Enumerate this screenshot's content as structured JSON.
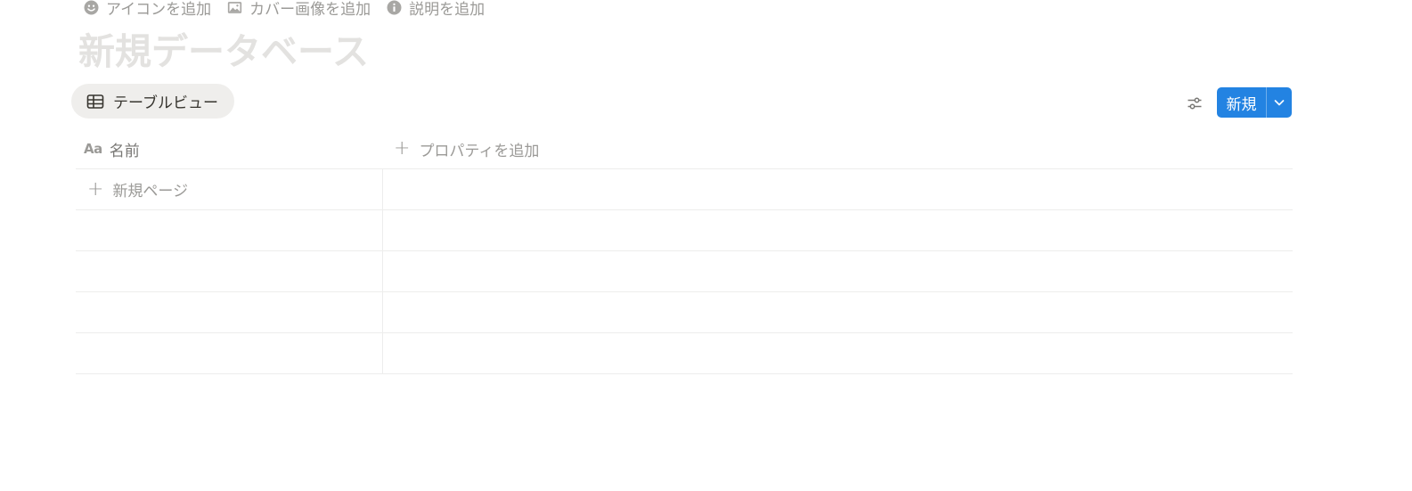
{
  "page_actions": {
    "add_icon": "アイコンを追加",
    "add_cover": "カバー画像を追加",
    "add_description": "説明を追加"
  },
  "database": {
    "title": "新規データベース"
  },
  "view": {
    "tab_label": "テーブルビュー"
  },
  "toolbar": {
    "new_label": "新規"
  },
  "table": {
    "columns": [
      {
        "icon": "Aa",
        "label": "名前"
      }
    ],
    "add_property_label": "プロパティを追加",
    "new_page_label": "新規ページ"
  },
  "colors": {
    "accent": "#2383e2",
    "muted_text": "#9b9a97",
    "title_placeholder": "#e3e2e0",
    "tab_bg": "#efeeec",
    "border": "#ededec"
  }
}
